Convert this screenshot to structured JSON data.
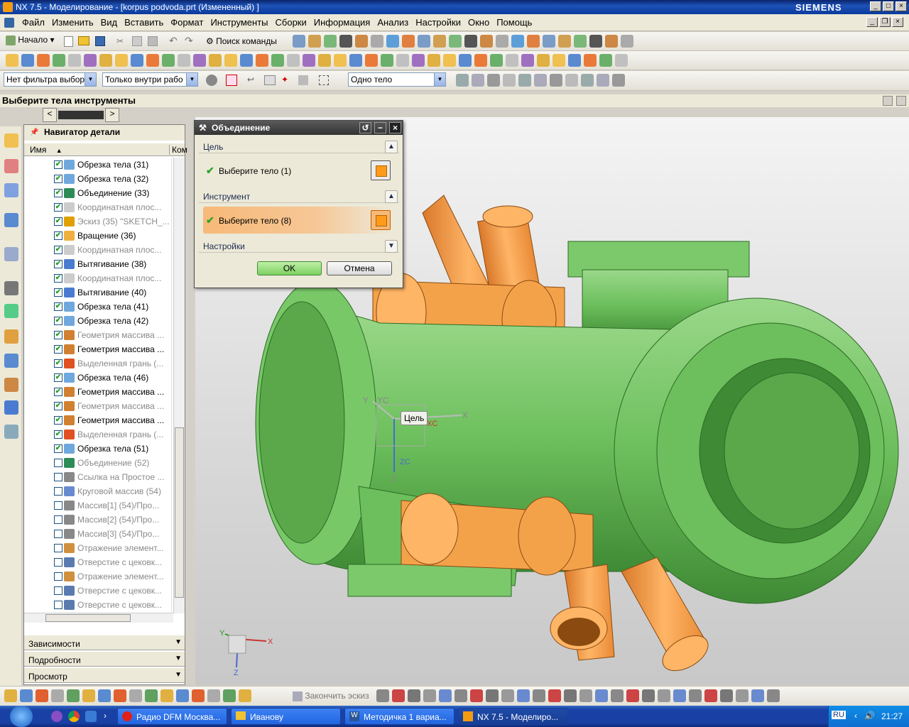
{
  "window": {
    "title": "NX 7.5 - Моделирование - [korpus podvoda.prt (Измененный) ]",
    "brand": "SIEMENS"
  },
  "menu": [
    "Файл",
    "Изменить",
    "Вид",
    "Вставить",
    "Формат",
    "Инструменты",
    "Сборки",
    "Информация",
    "Анализ",
    "Настройки",
    "Окно",
    "Помощь"
  ],
  "toolbar1": {
    "start_label": "Начало",
    "command_search": "Поиск команды"
  },
  "selection_bar": {
    "type_filter": "Нет фильтра выбор",
    "scope_filter": "Только внутри рабо",
    "body_filter": "Одно тело"
  },
  "cue_line": "Выберите тела инструменты",
  "navigator": {
    "title": "Навигатор детали",
    "col_name": "Имя",
    "col_comment": "Ком",
    "rows": [
      {
        "label": "Обрезка тела (31)",
        "checked": true,
        "dim": false,
        "icon_color": "#6fa8dc"
      },
      {
        "label": "Обрезка тела (32)",
        "checked": true,
        "dim": false,
        "icon_color": "#6fa8dc"
      },
      {
        "label": "Объединение (33)",
        "checked": true,
        "dim": false,
        "icon_color": "#2e8b57"
      },
      {
        "label": "Координатная плос...",
        "checked": true,
        "dim": true,
        "icon_color": "#cccccc"
      },
      {
        "label": "Эскиз (35) \"SKETCH_...",
        "checked": true,
        "dim": true,
        "icon_color": "#e0a000"
      },
      {
        "label": "Вращение (36)",
        "checked": true,
        "dim": false,
        "icon_color": "#f0b040"
      },
      {
        "label": "Координатная плос...",
        "checked": true,
        "dim": true,
        "icon_color": "#cccccc"
      },
      {
        "label": "Вытягивание (38)",
        "checked": true,
        "dim": false,
        "icon_color": "#4a7bd0"
      },
      {
        "label": "Координатная плос...",
        "checked": true,
        "dim": true,
        "icon_color": "#cccccc"
      },
      {
        "label": "Вытягивание (40)",
        "checked": true,
        "dim": false,
        "icon_color": "#4a7bd0"
      },
      {
        "label": "Обрезка тела (41)",
        "checked": true,
        "dim": false,
        "icon_color": "#6fa8dc"
      },
      {
        "label": "Обрезка тела (42)",
        "checked": true,
        "dim": false,
        "icon_color": "#6fa8dc"
      },
      {
        "label": "Геометрия массива ...",
        "checked": true,
        "dim": true,
        "icon_color": "#d08030"
      },
      {
        "label": "Геометрия массива ...",
        "checked": true,
        "dim": false,
        "icon_color": "#d08030"
      },
      {
        "label": "Выделенная грань (...",
        "checked": true,
        "dim": true,
        "icon_color": "#e05020"
      },
      {
        "label": "Обрезка тела (46)",
        "checked": true,
        "dim": false,
        "icon_color": "#6fa8dc"
      },
      {
        "label": "Геометрия массива ...",
        "checked": true,
        "dim": false,
        "icon_color": "#d08030"
      },
      {
        "label": "Геометрия массива ...",
        "checked": true,
        "dim": true,
        "icon_color": "#d08030"
      },
      {
        "label": "Геометрия массива ...",
        "checked": true,
        "dim": false,
        "icon_color": "#d08030"
      },
      {
        "label": "Выделенная грань (...",
        "checked": true,
        "dim": true,
        "icon_color": "#e05020"
      },
      {
        "label": "Обрезка тела (51)",
        "checked": true,
        "dim": false,
        "icon_color": "#6fa8dc"
      },
      {
        "label": "Объединение (52)",
        "checked": false,
        "dim": true,
        "icon_color": "#2e8b57"
      },
      {
        "label": "Ссылка на Простое ...",
        "checked": false,
        "dim": true,
        "icon_color": "#888888"
      },
      {
        "label": "Круговой массив (54)",
        "checked": false,
        "dim": true,
        "icon_color": "#6a8ad0"
      },
      {
        "label": "Массив[1] (54)/Про...",
        "checked": false,
        "dim": true,
        "icon_color": "#888888"
      },
      {
        "label": "Массив[2] (54)/Про...",
        "checked": false,
        "dim": true,
        "icon_color": "#888888"
      },
      {
        "label": "Массив[3] (54)/Про...",
        "checked": false,
        "dim": true,
        "icon_color": "#888888"
      },
      {
        "label": "Отражение элемент...",
        "checked": false,
        "dim": true,
        "icon_color": "#d09040"
      },
      {
        "label": "Отверстие с цековк...",
        "checked": false,
        "dim": true,
        "icon_color": "#5a7ab0"
      },
      {
        "label": "Отражение элемент...",
        "checked": false,
        "dim": true,
        "icon_color": "#d09040"
      },
      {
        "label": "Отверстие с цековк...",
        "checked": false,
        "dim": true,
        "icon_color": "#5a7ab0"
      },
      {
        "label": "Отверстие с цековк...",
        "checked": false,
        "dim": true,
        "icon_color": "#5a7ab0"
      }
    ],
    "panels": [
      "Зависимости",
      "Подробности",
      "Просмотр"
    ]
  },
  "dialog": {
    "title": "Объединение",
    "target_group": "Цель",
    "target_select": "Выберите тело (1)",
    "tool_group": "Инструмент",
    "tool_select": "Выберите тело (8)",
    "settings_group": "Настройки",
    "ok": "OK",
    "cancel": "Отмена"
  },
  "viewport": {
    "wcs_tooltip": "Цель",
    "axis_labels": {
      "x": "X",
      "y": "Y",
      "z": "Z",
      "xc": "XC",
      "yc": "YC",
      "zc": "ZC"
    },
    "colors": {
      "target_body": "#78c068",
      "tool_body": "#f4a24a"
    }
  },
  "bottom_toolbar": {
    "finish_sketch": "Закончить эскиз"
  },
  "taskbar": {
    "tasks": [
      "Радио DFM Москва...",
      "Иванову",
      "Методичка 1 вариа...",
      "NX 7.5 - Моделиро..."
    ],
    "lang": "RU",
    "time": "21:27"
  }
}
